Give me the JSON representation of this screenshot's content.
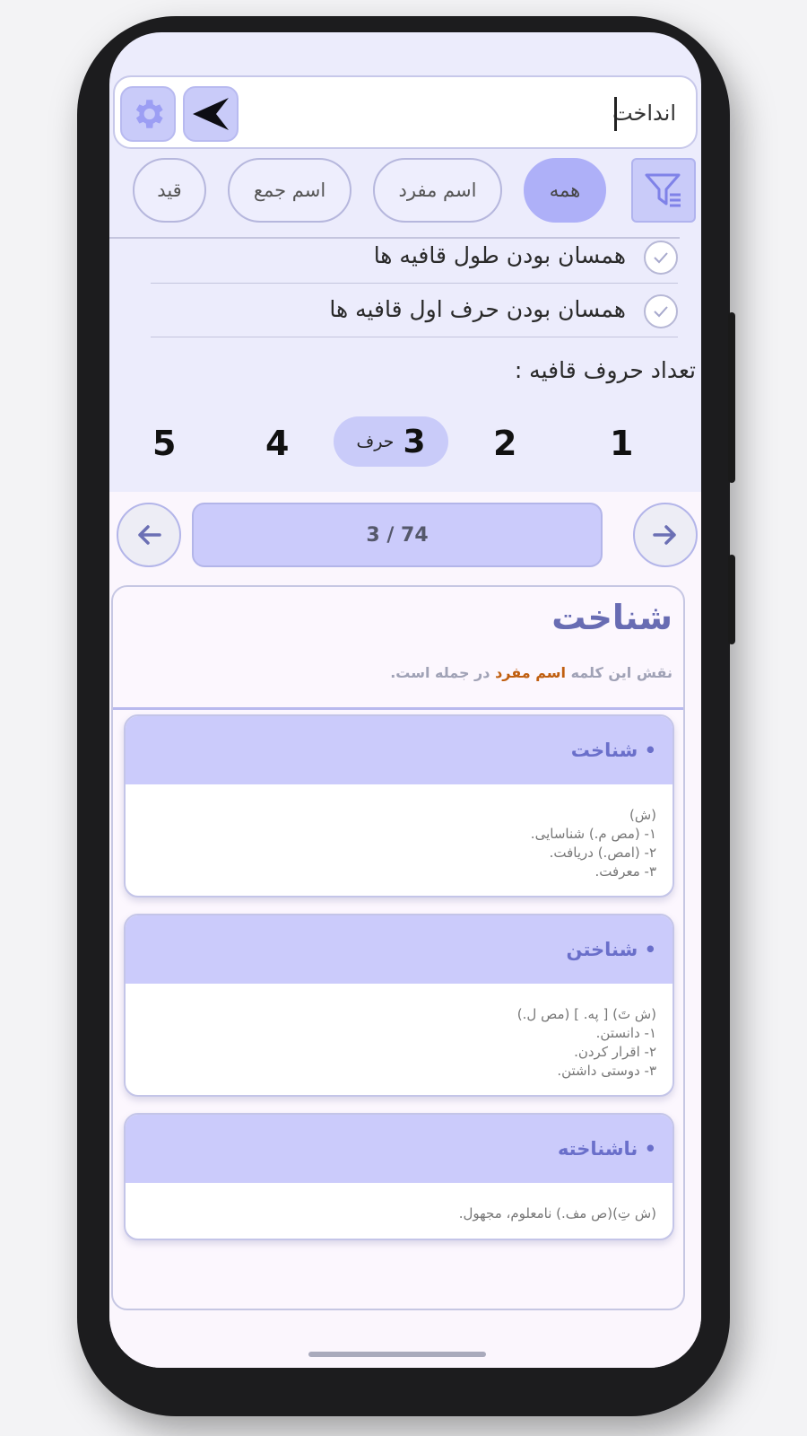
{
  "search": {
    "value": "انداخت",
    "placeholder": ""
  },
  "filters": {
    "chips": [
      {
        "label": "همه",
        "active": true
      },
      {
        "label": "اسم مفرد",
        "active": false
      },
      {
        "label": "اسم جمع",
        "active": false
      },
      {
        "label": "قید",
        "active": false
      }
    ]
  },
  "options": [
    {
      "label": "همسان بودن طول قافیه ها",
      "checked": true
    },
    {
      "label": "همسان بودن حرف اول قافیه ها",
      "checked": true
    }
  ],
  "rhyme_count": {
    "title": "تعداد حروف قافیه :",
    "values": [
      "1",
      "2",
      "3",
      "4",
      "5"
    ],
    "selected": "3",
    "unit": "حرف"
  },
  "pager": {
    "text": "3 / 74"
  },
  "result": {
    "word": "شناخت",
    "role_prefix": "نقش این کلمه",
    "role_highlight": "اسم مفرد",
    "role_suffix": "در جمله است."
  },
  "cards": [
    {
      "title": "• شناخت",
      "lines": [
        "(ش)",
        "۱- (مص م.) شناسایی.",
        "۲- (امص.) دریافت.",
        "۳- معرفت."
      ]
    },
    {
      "title": "• شناختن",
      "lines": [
        "(ش  تَ) [ په. ] (مص ل.)",
        "۱- دانستن.",
        "۲- اقرار کردن.",
        "۳- دوستی داشتن."
      ]
    },
    {
      "title": "• ناشناخته",
      "lines": [
        "(ش  تِ)(ص مف.) نامعلوم، مجهول."
      ]
    }
  ],
  "icons": {
    "send": "send-arrow-icon",
    "settings": "gear-icon",
    "filter": "filter-icon",
    "prev": "arrow-left-icon",
    "next": "arrow-right-icon"
  },
  "colors": {
    "accent": "#aeb0f8",
    "panel": "#cbcbfb",
    "highlight": "#c05f10",
    "title": "#686cb3"
  }
}
